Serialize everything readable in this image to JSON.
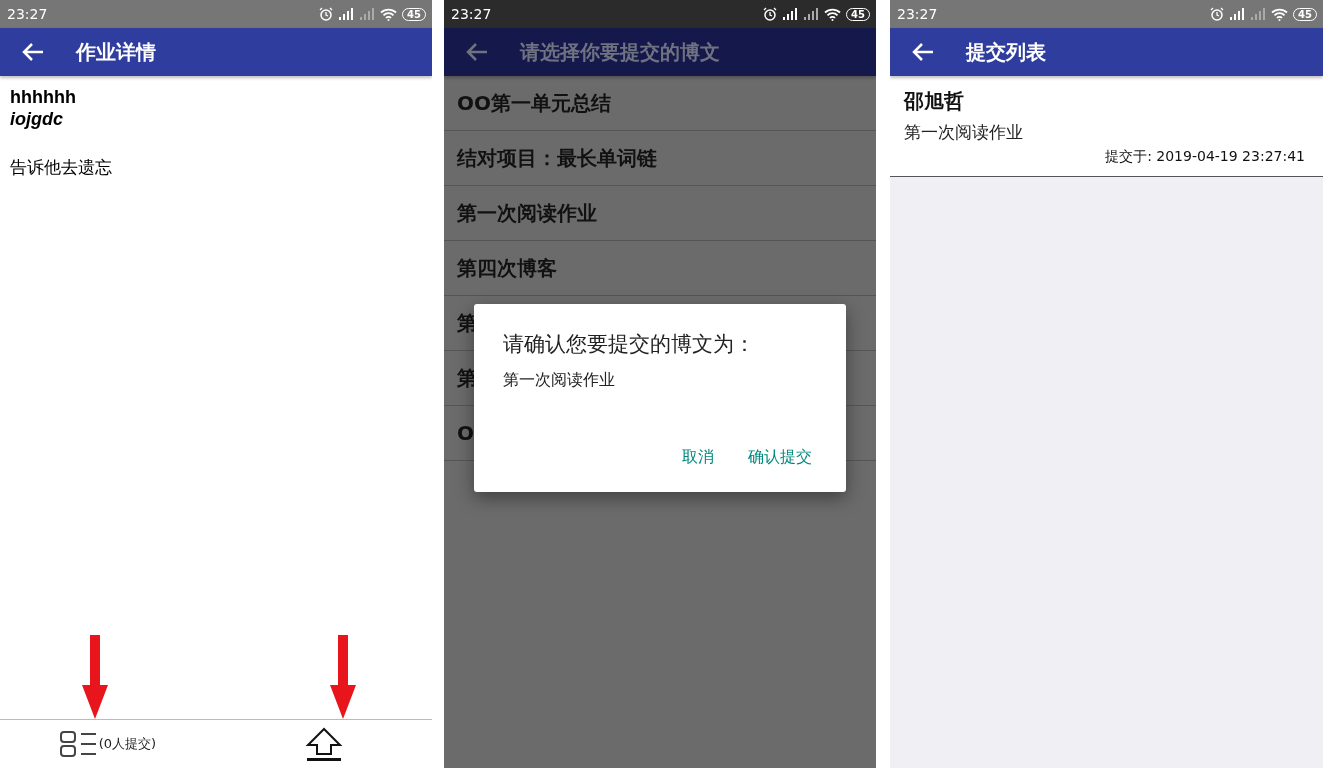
{
  "detail_screen": {
    "status_bar": {
      "time": "23:27",
      "battery": "45"
    },
    "app_bar": {
      "title": "作业详情"
    },
    "heading": "hhhhhh",
    "subheading": "iojgdc",
    "body": "告诉他去遗忘",
    "bottom_bar": {
      "submissions_label": "(0人提交)"
    }
  },
  "picker_screen": {
    "status_bar": {
      "time": "23:27",
      "battery": "45"
    },
    "app_bar": {
      "title": "请选择你要提交的博文"
    },
    "posts": [
      "OO第一单元总结",
      "结对项目：最长单词链",
      "第一次阅读作业",
      "第四次博客",
      "第",
      "第",
      "O"
    ],
    "dialog": {
      "title": "请确认您要提交的博文为：",
      "message": "第一次阅读作业",
      "buttons": [
        "取消",
        "确认提交"
      ]
    }
  },
  "submissions_screen": {
    "status_bar": {
      "time": "23:27",
      "battery": "45"
    },
    "app_bar": {
      "title": "提交列表"
    },
    "submissions": [
      {
        "name": "邵旭哲",
        "post": "第一次阅读作业",
        "submitted_at": "提交于: 2019-04-19 23:27:41"
      }
    ]
  }
}
